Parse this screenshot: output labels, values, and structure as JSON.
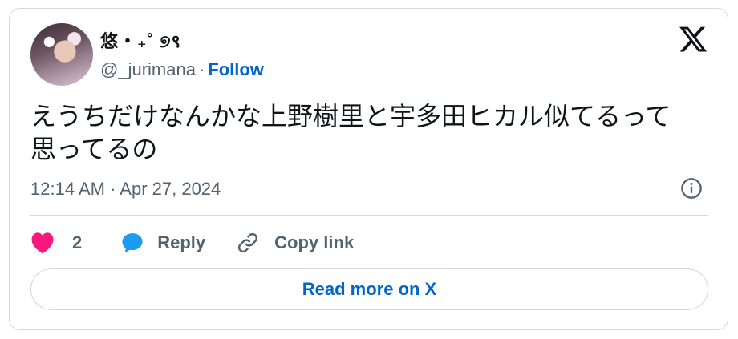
{
  "user": {
    "display_name": "悠・₊˚ ୭९",
    "handle": "@_jurimana",
    "separator": "·",
    "follow_label": "Follow"
  },
  "tweet": {
    "text_line1": "えうちだけなんかな上野樹里と宇多田ヒカル似てるって",
    "text_line2": "思ってるの",
    "timestamp": "12:14 AM · Apr 27, 2024"
  },
  "actions": {
    "like_count": "2",
    "reply_label": "Reply",
    "copy_link_label": "Copy link"
  },
  "footer": {
    "read_more_label": "Read more on X"
  },
  "colors": {
    "like": "#f91880",
    "reply": "#1d9bf0",
    "link": "#0066cc",
    "muted": "#536471",
    "border": "#cfd9de"
  },
  "icons": [
    "x-logo-icon",
    "info-icon",
    "heart-icon",
    "reply-bubble-icon",
    "link-icon"
  ]
}
